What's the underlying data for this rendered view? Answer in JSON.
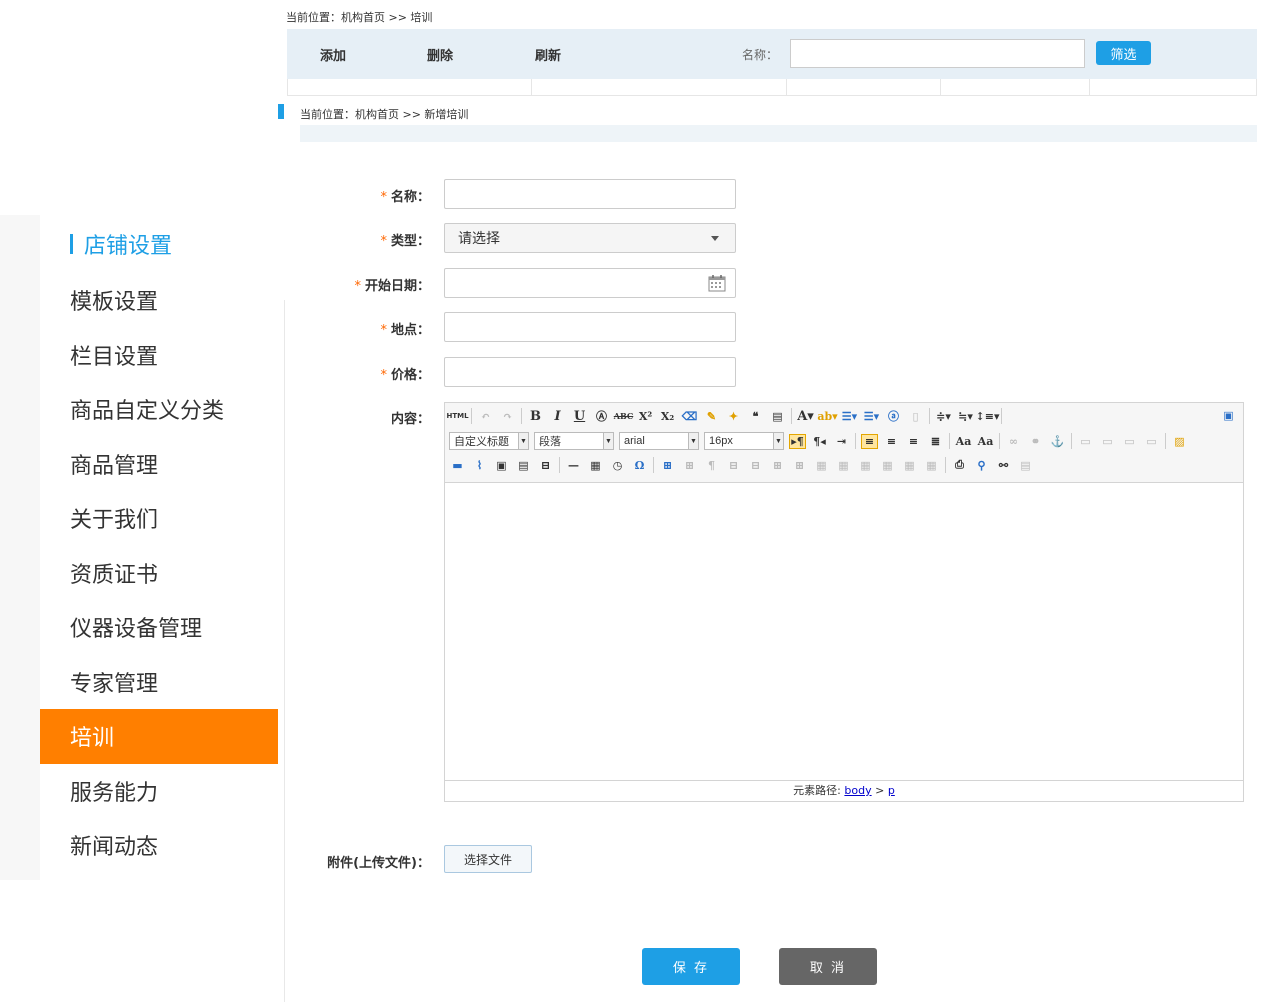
{
  "background_page": {
    "breadcrumb": "当前位置：机构首页 >> 培训",
    "toolbar": {
      "add": "添加",
      "delete": "删除",
      "refresh": "刷新",
      "filter_label": "名称：",
      "filter_value": "",
      "filter_button": "筛选"
    }
  },
  "sidebar": {
    "title": "店铺设置",
    "items": [
      {
        "label": "模板设置"
      },
      {
        "label": "栏目设置"
      },
      {
        "label": "商品自定义分类"
      },
      {
        "label": "商品管理"
      },
      {
        "label": "关于我们"
      },
      {
        "label": "资质证书"
      },
      {
        "label": "仪器设备管理"
      },
      {
        "label": "专家管理"
      },
      {
        "label": "培训"
      },
      {
        "label": "服务能力"
      },
      {
        "label": "新闻动态"
      }
    ],
    "active_item": "培训"
  },
  "form": {
    "breadcrumb": "当前位置：机构首页 >> 新增培训",
    "required_mark": "*",
    "name_label": "名称：",
    "name_value": "",
    "type_label": "类型：",
    "type_value": "请选择",
    "start_date_label": "开始日期：",
    "start_date_value": "",
    "location_label": "地点：",
    "location_value": "",
    "price_label": "价格：",
    "price_value": "",
    "content_label": "内容：",
    "attachment_label": "附件(上传文件)：",
    "choose_file_button": "选择文件",
    "save_button": "保 存",
    "cancel_button": "取 消"
  },
  "editor": {
    "html_button": "HTML",
    "heading_combo": "自定义标题",
    "paragraph_combo": "段落",
    "font_combo": "arial",
    "size_combo": "16px",
    "status_prefix": "元素路径:",
    "path_body": "body",
    "path_sep": ">",
    "path_p": "p"
  },
  "colors": {
    "accent": "#1e9fe5",
    "active_menu": "#ff7f00",
    "required": "#ff6600",
    "cancel": "#666666"
  }
}
